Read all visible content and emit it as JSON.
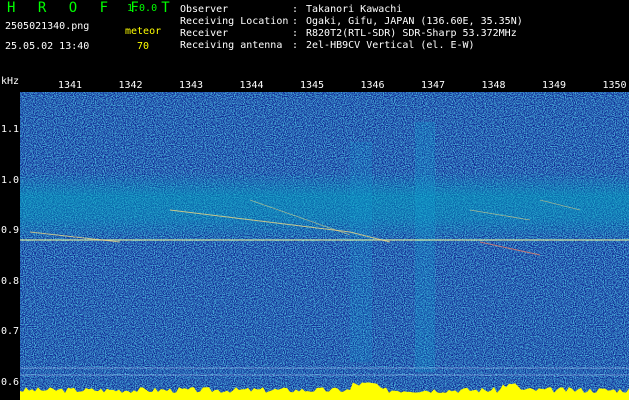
{
  "header": {
    "brand": "H R O F F T",
    "version": "1.0.0",
    "filename": "2505021340.png",
    "datetime": "25.05.02 13:40",
    "meteor_label": "meteor",
    "meteor_count": "70"
  },
  "info": [
    {
      "label": "Observer",
      "value": "Takanori Kawachi"
    },
    {
      "label": "Receiving Location",
      "value": "Ogaki, Gifu, JAPAN (136.60E, 35.35N)"
    },
    {
      "label": "Receiver",
      "value": "R820T2(RTL-SDR) SDR-Sharp 53.372MHz"
    },
    {
      "label": "Receiving antenna",
      "value": "2el-HB9CV Vertical (el. E-W)"
    }
  ],
  "axis": {
    "unit": "kHz",
    "time_ticks": [
      "1341",
      "1342",
      "1343",
      "1344",
      "1345",
      "1346",
      "1347",
      "1348",
      "1349",
      "1350"
    ],
    "freq_ticks": [
      "1.1",
      "1.0",
      "0.9",
      "0.8",
      "0.7",
      "0.6"
    ],
    "freq_range": [
      0.6,
      1.15
    ]
  },
  "colors": {
    "background": "#0a1a8c",
    "noise_band": "#00a0c0",
    "signal": "#e8f8a0",
    "level_bar": "#ffff00",
    "brand": "#00ff00"
  }
}
